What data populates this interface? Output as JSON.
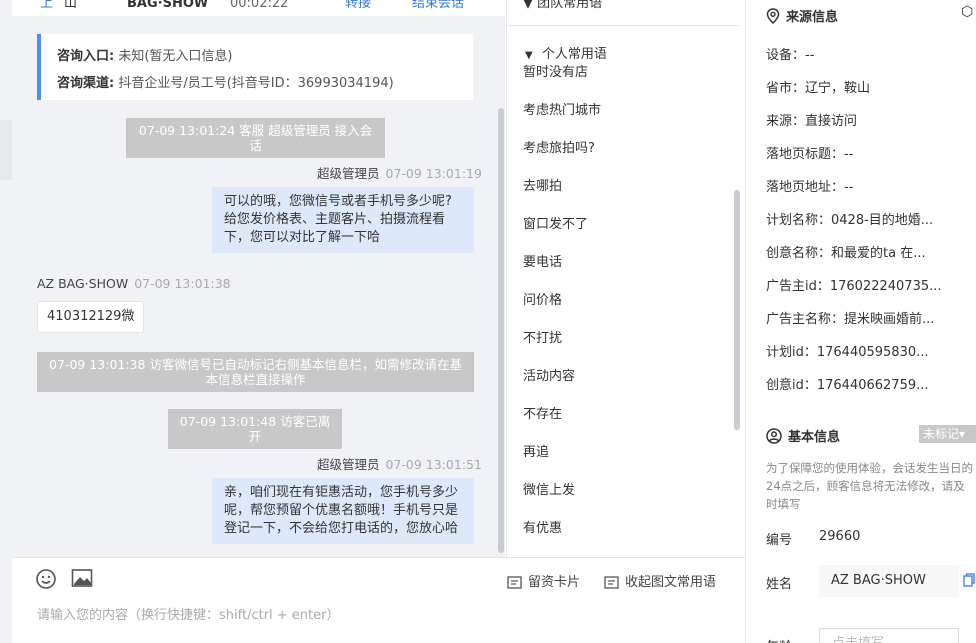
{
  "chat_header": {
    "back": "上",
    "user": "山",
    "brand": "BAG·SHOW",
    "time": "00:02:22",
    "transfer": "转接",
    "end": "结束会话"
  },
  "inquiry": {
    "entry_label": "咨询入口:",
    "entry_value": "未知(暂无入口信息)",
    "channel_label": "咨询渠道:",
    "channel_value": "抖音企业号/员工号(抖音号ID：36993034194)"
  },
  "messages": {
    "sys1": "07-09 13:01:24 客服 超级管理员 接入会话",
    "agent1_name": "超级管理员",
    "agent1_time": "07-09 13:01:19",
    "agent1_text": "可以的哦，您微信号或者手机号多少呢?给您发价格表、主题客片、拍摄流程看下，您可以对比了解一下哈",
    "visitor_name": "AZ BAG·SHOW",
    "visitor_time": "07-09 13:01:38",
    "visitor_text": "410312129微",
    "sys2": "07-09 13:01:38 访客微信号已自动标记右侧基本信息栏，如需修改请在基本信息栏直接操作",
    "sys3": "07-09 13:01:48 访客已离开",
    "agent2_name": "超级管理员",
    "agent2_time": "07-09 13:01:51",
    "agent2_text": "亲，咱们现在有钜惠活动，您手机号多少呢，帮您预留个优惠名额哦！手机号只是登记一下，不会给您打电话的，您放心哈"
  },
  "input": {
    "placeholder": "请输入您的内容（换行快捷键：shift/ctrl + enter）",
    "card_label": "留资卡片",
    "collapse_label": "收起图文常用语"
  },
  "phrases": {
    "top_group": "团队常用语",
    "group_title": "个人常用语",
    "items": [
      "暂时没有店",
      "考虑热门城市",
      "考虑旅拍吗?",
      "去哪拍",
      "窗口发不了",
      "要电话",
      "问价格",
      "不打扰",
      "活动内容",
      "不存在",
      "再追",
      "微信上发",
      "有优惠"
    ]
  },
  "source_info": {
    "title": "来源信息",
    "rows": [
      "设备：--",
      "省市：辽宁，鞍山",
      "来源：直接访问",
      "落地页标题：--",
      "落地页地址：--",
      "计划名称：0428-目的地婚...",
      "创意名称：和最爱的ta 在...",
      "广告主id：176022240735...",
      "广告主名称：提米映画婚前...",
      "计划id：176440595830...",
      "创意id：176440662759..."
    ]
  },
  "basic_info": {
    "title": "基本信息",
    "tag": "未标记▾",
    "notice": "为了保障您的使用体验，会话发生当日的24点之后，顾客信息将无法修改，请及时填写",
    "id_label": "编号",
    "id_value": "29660",
    "name_label": "姓名",
    "name_value": "AZ BAG·SHOW",
    "age_label": "年龄",
    "age_placeholder": "点击填写"
  }
}
